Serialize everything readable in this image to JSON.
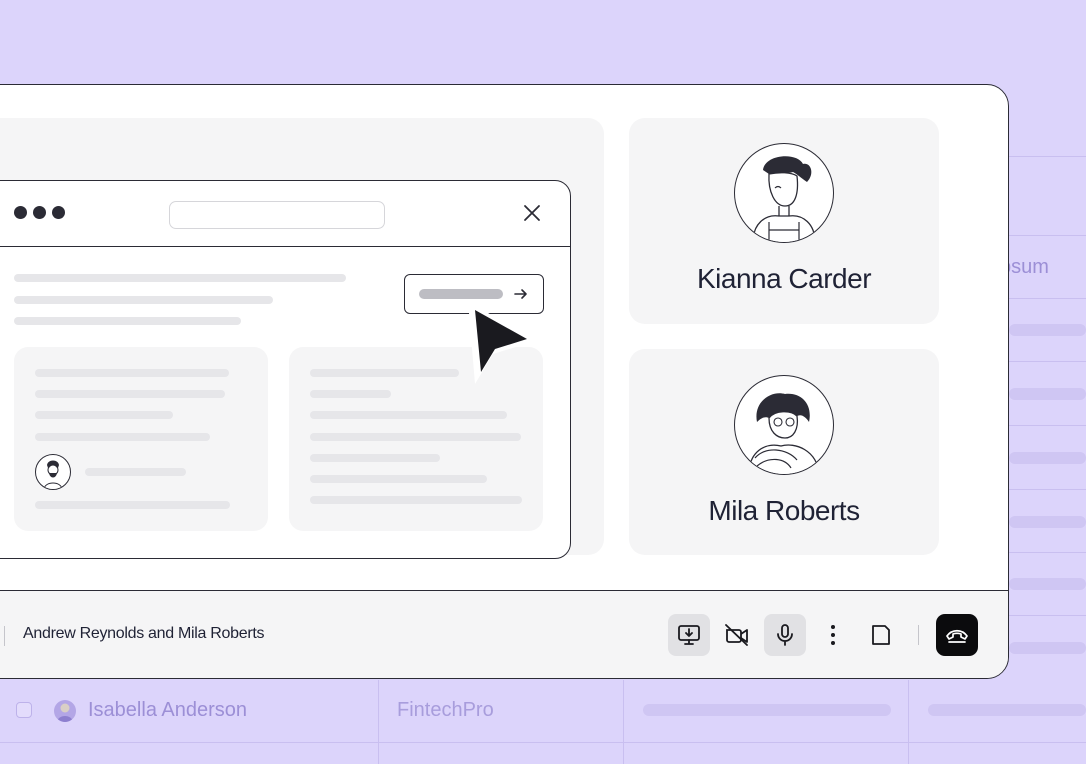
{
  "background_table": {
    "row": {
      "name": "Isabella Anderson",
      "company": "FintechPro"
    },
    "partial_text": "psum"
  },
  "shared_screen": {
    "window_dots": 3,
    "close_icon": "close-icon",
    "action_icon": "arrow-right-icon",
    "cursor_icon": "pointer-cursor-icon"
  },
  "participants": [
    {
      "name": "Kianna Carder",
      "avatar": "woman-avatar-illustration"
    },
    {
      "name": "Mila Roberts",
      "avatar": "woman-glasses-avatar-illustration"
    }
  ],
  "call_bar": {
    "title": "Andrew Reynolds and Mila Roberts",
    "controls": [
      {
        "icon": "screen-share-icon",
        "active": true
      },
      {
        "icon": "camera-off-icon",
        "active": false
      },
      {
        "icon": "microphone-icon",
        "active": true
      },
      {
        "icon": "more-vertical-icon",
        "active": false
      },
      {
        "icon": "note-icon",
        "active": false
      },
      {
        "icon": "hang-up-icon",
        "active": false
      }
    ]
  },
  "colors": {
    "background": "#dcd4fb",
    "window": "#ffffff",
    "panel": "#f5f5f6",
    "text": "#1f2235",
    "hangup": "#0b0b0d"
  }
}
